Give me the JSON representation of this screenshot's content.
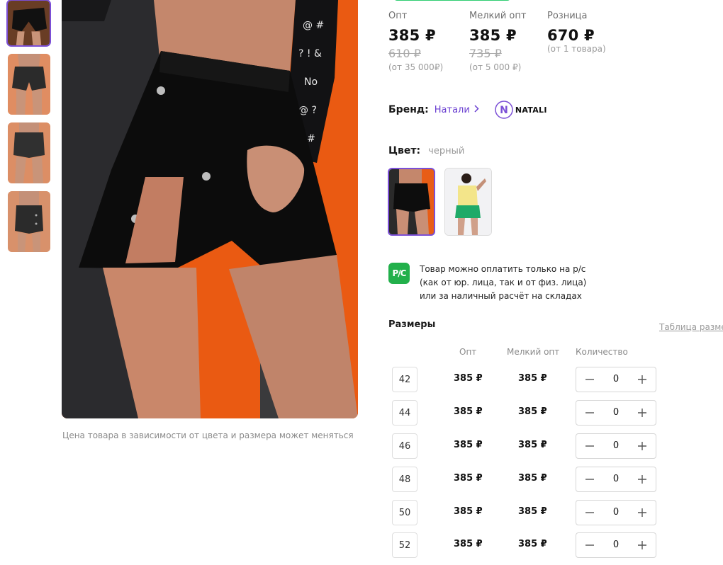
{
  "prices": [
    {
      "label": "Опт",
      "price": "385 ₽",
      "old_price": "610 ₽",
      "condition": "(от 35 000₽)"
    },
    {
      "label": "Мелкий опт",
      "price": "385 ₽",
      "old_price": "735 ₽",
      "condition": "(от 5 000 ₽)"
    },
    {
      "label": "Розница",
      "price": "670 ₽",
      "old_price": "",
      "condition": "(от 1 товара)"
    }
  ],
  "brand": {
    "label": "Бренд:",
    "name": "Натали",
    "logo_text": "NATALI",
    "logo_letter": "N",
    "accent": "#7b4fd6"
  },
  "color": {
    "label": "Цвет:",
    "value": "черный"
  },
  "payment": {
    "icon_text": "P/C",
    "lines": [
      "Товар можно оплатить только на р/с",
      "(как от юр. лица, так и от физ. лица)",
      "или за наличный расчёт на складах"
    ]
  },
  "photo_note": "Цена товара в зависимости от цвета и размера может меняться",
  "sizes": {
    "title": "Размеры",
    "table_link": "Таблица размеров",
    "columns": [
      "Опт",
      "Мелкий опт",
      "Количество"
    ],
    "rows": [
      {
        "size": "42",
        "opt": "385 ₽",
        "small_opt": "385 ₽",
        "qty": "0"
      },
      {
        "size": "44",
        "opt": "385 ₽",
        "small_opt": "385 ₽",
        "qty": "0"
      },
      {
        "size": "46",
        "opt": "385 ₽",
        "small_opt": "385 ₽",
        "qty": "0"
      },
      {
        "size": "48",
        "opt": "385 ₽",
        "small_opt": "385 ₽",
        "qty": "0"
      },
      {
        "size": "50",
        "opt": "385 ₽",
        "small_opt": "385 ₽",
        "qty": "0"
      },
      {
        "size": "52",
        "opt": "385 ₽",
        "small_opt": "385 ₽",
        "qty": "0"
      }
    ]
  },
  "colors": {
    "accent": "#7b4fd6",
    "pay_green": "#22b04b",
    "photo_bg": "#ea5a12"
  }
}
